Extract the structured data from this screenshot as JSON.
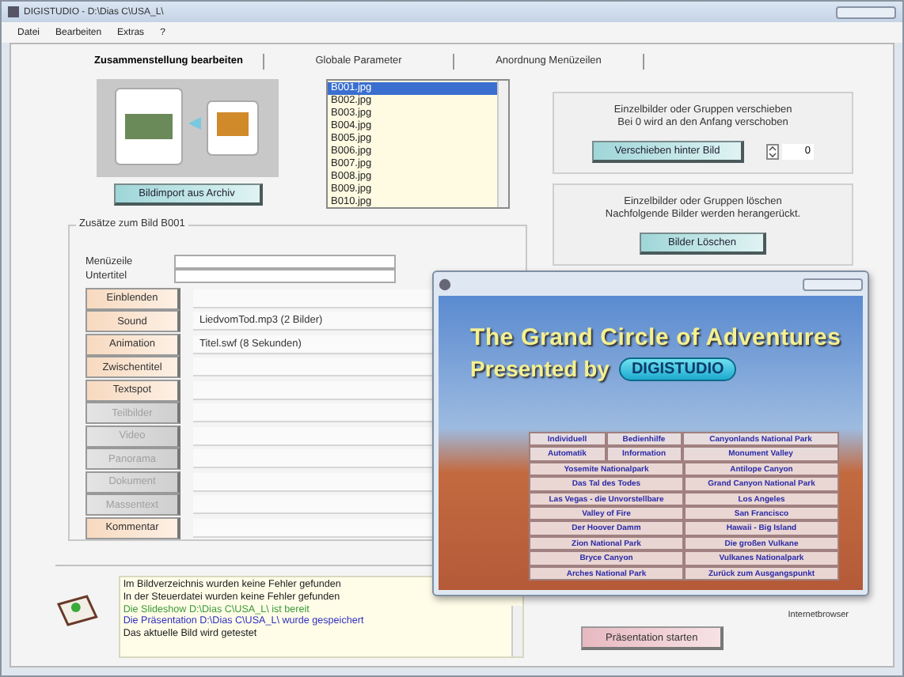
{
  "window": {
    "title": "DIGISTUDIO - D:\\Dias C\\USA_L\\"
  },
  "menu": [
    "Datei",
    "Bearbeiten",
    "Extras",
    "?"
  ],
  "tabs": [
    {
      "label": "Zusammenstellung bearbeiten",
      "selected": true
    },
    {
      "label": "Globale Parameter",
      "selected": false
    },
    {
      "label": "Anordnung Menüzeilen",
      "selected": false
    }
  ],
  "import_button": "Bildimport aus Archiv",
  "image_list": [
    {
      "label": "B001.jpg",
      "selected": true
    },
    {
      "label": "B002.jpg",
      "selected": false
    },
    {
      "label": "B003.jpg",
      "selected": false
    },
    {
      "label": "B004.jpg",
      "selected": false
    },
    {
      "label": "B005.jpg",
      "selected": false
    },
    {
      "label": "B006.jpg",
      "selected": false
    },
    {
      "label": "B007.jpg",
      "selected": false
    },
    {
      "label": "B008.jpg",
      "selected": false
    },
    {
      "label": "B009.jpg",
      "selected": false
    },
    {
      "label": "B010.jpg",
      "selected": false
    }
  ],
  "move_panel": {
    "text": "Einzelbilder oder Gruppen verschieben",
    "hint": "Bei 0 wird an den Anfang verschoben",
    "button": "Verschieben hinter Bild",
    "value": "0"
  },
  "delete_panel": {
    "text": "Einzelbilder oder Gruppen löschen",
    "hint": "Nachfolgende Bilder werden herangerückt.",
    "button": "Bilder Löschen"
  },
  "extras": {
    "title": "Zusätze zum Bild B001",
    "fields": [
      {
        "label": "Menüzeile"
      },
      {
        "label": "Untertitel"
      }
    ],
    "rows": [
      {
        "button": "Einblenden",
        "disabled": false
      },
      {
        "button": "Sound",
        "disabled": false,
        "value": "LiedvomTod.mp3   (2 Bilder)"
      },
      {
        "button": "Animation",
        "disabled": false,
        "value": "Titel.swf   (8 Sekunden)"
      },
      {
        "button": "Zwischentitel",
        "disabled": false
      },
      {
        "button": "Textspot",
        "disabled": false
      },
      {
        "button": "Teilbilder",
        "disabled": true
      },
      {
        "button": "Video",
        "disabled": true
      },
      {
        "button": "Panorama",
        "disabled": true
      },
      {
        "button": "Dokument",
        "disabled": true
      },
      {
        "button": "Massentext",
        "disabled": true
      },
      {
        "button": "Kommentar",
        "disabled": false
      }
    ]
  },
  "log": [
    {
      "text": "Im Bildverzeichnis wurden keine Fehler gefunden",
      "color": "#202020"
    },
    {
      "text": "In der Steuerdatei wurden keine Fehler gefunden",
      "color": "#202020"
    },
    {
      "text": "Die Slideshow D:\\Dias C\\USA_L\\ ist bereit",
      "color": "#3a9a3a"
    },
    {
      "text": "Die Präsentation D:\\Dias C\\USA_L\\ wurde gespeichert",
      "color": "#3030c0"
    },
    {
      "text": "Das aktuelle Bild wird getestet",
      "color": "#202020"
    }
  ],
  "start_button": "Präsentation starten",
  "browser_label": "Internetbrowser",
  "preview": {
    "title": "The Grand Circle of Adventures",
    "presented": "Presented by",
    "logo": "DIGISTUDIO",
    "rows": [
      [
        "Individuell",
        "Bedienhilfe",
        "Canyonlands National Park"
      ],
      [
        "Automatik",
        "Information",
        "Monument Valley"
      ],
      [
        "Yosemite Nationalpark",
        "Antilope Canyon"
      ],
      [
        "Das Tal des Todes",
        "Grand Canyon National Park"
      ],
      [
        "Las Vegas - die Unvorstellbare",
        "Los Angeles"
      ],
      [
        "Valley of Fire",
        "San Francisco"
      ],
      [
        "Der Hoover Damm",
        "Hawaii - Big Island"
      ],
      [
        "Zion National Park",
        "Die großen Vulkane"
      ],
      [
        "Bryce Canyon",
        "Vulkanes Nationalpark"
      ],
      [
        "Arches National Park",
        "Zurück zum Ausgangspunkt"
      ]
    ]
  }
}
